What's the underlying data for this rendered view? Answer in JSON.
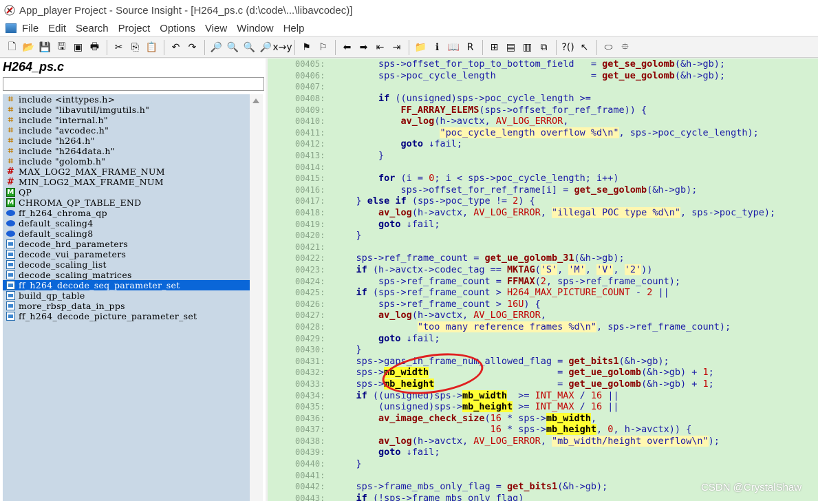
{
  "window": {
    "title": "App_player Project - Source Insight - [H264_ps.c (d:\\code\\...\\libavcodec)]"
  },
  "menu": [
    "File",
    "Edit",
    "Search",
    "Project",
    "Options",
    "View",
    "Window",
    "Help"
  ],
  "toolbar_icons": [
    "new-file-icon",
    "open-folder-icon",
    "save-icon",
    "save-all-icon",
    "close-icon",
    "print-icon",
    "cut-icon",
    "copy-icon",
    "paste-icon",
    "undo-icon",
    "redo-icon",
    "find-icon",
    "find-prev-icon",
    "find-next-icon",
    "find-files-icon",
    "replace-icon",
    "bookmark-icon",
    "bookmark-next-icon",
    "back-icon",
    "forward-icon",
    "jump-prev-icon",
    "jump-next-icon",
    "project-icon",
    "symbol-info-icon",
    "book-icon",
    "relation-icon",
    "window-icon",
    "layout-icon",
    "layout2-icon",
    "layout3-icon",
    "lookup-icon",
    "pointer-icon",
    "view-icon",
    "expand-icon"
  ],
  "left_panel": {
    "file_title": "H264_ps.c",
    "search_value": "",
    "symbols": [
      {
        "icon": "include",
        "label": "include <inttypes.h>"
      },
      {
        "icon": "include",
        "label": "include \"libavutil/imgutils.h\""
      },
      {
        "icon": "include",
        "label": "include \"internal.h\""
      },
      {
        "icon": "include",
        "label": "include \"avcodec.h\""
      },
      {
        "icon": "include",
        "label": "include \"h264.h\""
      },
      {
        "icon": "include",
        "label": "include \"h264data.h\""
      },
      {
        "icon": "include",
        "label": "include \"golomb.h\""
      },
      {
        "icon": "define",
        "label": "MAX_LOG2_MAX_FRAME_NUM"
      },
      {
        "icon": "define",
        "label": "MIN_LOG2_MAX_FRAME_NUM"
      },
      {
        "icon": "macro",
        "label": "QP"
      },
      {
        "icon": "macro",
        "label": "CHROMA_QP_TABLE_END"
      },
      {
        "icon": "variable",
        "label": "ff_h264_chroma_qp"
      },
      {
        "icon": "variable",
        "label": "default_scaling4"
      },
      {
        "icon": "variable",
        "label": "default_scaling8"
      },
      {
        "icon": "function",
        "label": "decode_hrd_parameters"
      },
      {
        "icon": "function",
        "label": "decode_vui_parameters"
      },
      {
        "icon": "function",
        "label": "decode_scaling_list"
      },
      {
        "icon": "function",
        "label": "decode_scaling_matrices"
      },
      {
        "icon": "function",
        "label": "ff_h264_decode_seq_parameter_set",
        "selected": true
      },
      {
        "icon": "function",
        "label": "build_qp_table"
      },
      {
        "icon": "function",
        "label": "more_rbsp_data_in_pps"
      },
      {
        "icon": "function",
        "label": "ff_h264_decode_picture_parameter_set"
      }
    ]
  },
  "editor": {
    "lines": [
      {
        "no": "00405:",
        "code": "        sps->offset_for_top_to_bottom_field   = get_se_golomb(&h->gb);"
      },
      {
        "no": "00406:",
        "code": "        sps->poc_cycle_length                 = get_ue_golomb(&h->gb);"
      },
      {
        "no": "00407:",
        "code": ""
      },
      {
        "no": "00408:",
        "code": "        if ((unsigned)sps->poc_cycle_length >="
      },
      {
        "no": "00409:",
        "code": "            FF_ARRAY_ELEMS(sps->offset_for_ref_frame)) {"
      },
      {
        "no": "00410:",
        "code": "            av_log(h->avctx, AV_LOG_ERROR,"
      },
      {
        "no": "00411:",
        "code": "                   \"poc_cycle_length overflow %d\\n\", sps->poc_cycle_length);"
      },
      {
        "no": "00412:",
        "code": "            goto ↓fail;"
      },
      {
        "no": "00413:",
        "code": "        }"
      },
      {
        "no": "00414:",
        "code": ""
      },
      {
        "no": "00415:",
        "code": "        for (i = 0; i < sps->poc_cycle_length; i++)"
      },
      {
        "no": "00416:",
        "code": "            sps->offset_for_ref_frame[i] = get_se_golomb(&h->gb);"
      },
      {
        "no": "00417:",
        "code": "    } else if (sps->poc_type != 2) {"
      },
      {
        "no": "00418:",
        "code": "        av_log(h->avctx, AV_LOG_ERROR, \"illegal POC type %d\\n\", sps->poc_type);"
      },
      {
        "no": "00419:",
        "code": "        goto ↓fail;"
      },
      {
        "no": "00420:",
        "code": "    }"
      },
      {
        "no": "00421:",
        "code": ""
      },
      {
        "no": "00422:",
        "code": "    sps->ref_frame_count = get_ue_golomb_31(&h->gb);"
      },
      {
        "no": "00423:",
        "code": "    if (h->avctx->codec_tag == MKTAG('S', 'M', 'V', '2'))"
      },
      {
        "no": "00424:",
        "code": "        sps->ref_frame_count = FFMAX(2, sps->ref_frame_count);"
      },
      {
        "no": "00425:",
        "code": "    if (sps->ref_frame_count > H264_MAX_PICTURE_COUNT - 2 ||"
      },
      {
        "no": "00426:",
        "code": "        sps->ref_frame_count > 16U) {"
      },
      {
        "no": "00427:",
        "code": "        av_log(h->avctx, AV_LOG_ERROR,"
      },
      {
        "no": "00428:",
        "code": "               \"too many reference frames %d\\n\", sps->ref_frame_count);"
      },
      {
        "no": "00429:",
        "code": "        goto ↓fail;"
      },
      {
        "no": "00430:",
        "code": "    }"
      },
      {
        "no": "00431:",
        "code": "    sps->gaps_in_frame_num_allowed_flag = get_bits1(&h->gb);"
      },
      {
        "no": "00432:",
        "code": "    sps->mb_width                       = get_ue_golomb(&h->gb) + 1;"
      },
      {
        "no": "00433:",
        "code": "    sps->mb_height                      = get_ue_golomb(&h->gb) + 1;"
      },
      {
        "no": "00434:",
        "code": "    if ((unsigned)sps->mb_width  >= INT_MAX / 16 ||"
      },
      {
        "no": "00435:",
        "code": "        (unsigned)sps->mb_height >= INT_MAX / 16 ||"
      },
      {
        "no": "00436:",
        "code": "        av_image_check_size(16 * sps->mb_width,"
      },
      {
        "no": "00437:",
        "code": "                            16 * sps->mb_height, 0, h->avctx)) {"
      },
      {
        "no": "00438:",
        "code": "        av_log(h->avctx, AV_LOG_ERROR, \"mb_width/height overflow\\n\");"
      },
      {
        "no": "00439:",
        "code": "        goto ↓fail;"
      },
      {
        "no": "00440:",
        "code": "    }"
      },
      {
        "no": "00441:",
        "code": ""
      },
      {
        "no": "00442:",
        "code": "    sps->frame_mbs_only_flag = get_bits1(&h->gb);"
      },
      {
        "no": "00443:",
        "code": "    if (!sps->frame_mbs_only_flag)"
      }
    ]
  },
  "watermark": "CSDN @CrystalShaw",
  "colors": {
    "editor_bg": "#d5f1d2",
    "symbol_bg": "#c9d8e6",
    "selection": "#0a66d8",
    "highlight": "#ffff33",
    "annotation": "#e02020"
  }
}
